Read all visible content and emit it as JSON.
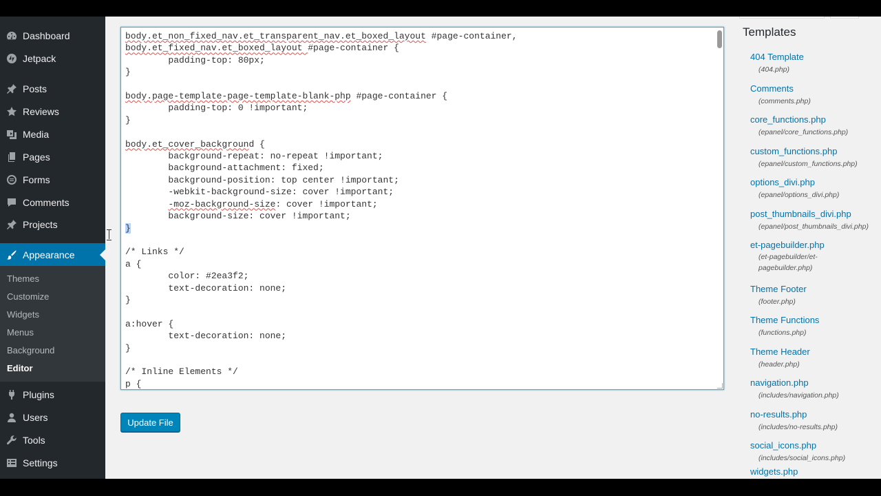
{
  "sidebar": {
    "items": [
      {
        "label": "Dashboard",
        "icon": "dashboard-icon"
      },
      {
        "label": "Jetpack",
        "icon": "jetpack-icon"
      },
      {
        "label": "Posts",
        "icon": "pin-icon"
      },
      {
        "label": "Reviews",
        "icon": "star-icon"
      },
      {
        "label": "Media",
        "icon": "media-icon"
      },
      {
        "label": "Pages",
        "icon": "page-icon"
      },
      {
        "label": "Forms",
        "icon": "forms-icon"
      },
      {
        "label": "Comments",
        "icon": "comment-icon"
      },
      {
        "label": "Projects",
        "icon": "pin-icon"
      },
      {
        "label": "Appearance",
        "icon": "brush-icon"
      },
      {
        "label": "Plugins",
        "icon": "plug-icon"
      },
      {
        "label": "Users",
        "icon": "user-icon"
      },
      {
        "label": "Tools",
        "icon": "wrench-icon"
      },
      {
        "label": "Settings",
        "icon": "settings-icon"
      }
    ],
    "active": "Appearance",
    "submenu": [
      "Themes",
      "Customize",
      "Widgets",
      "Menus",
      "Background",
      "Editor"
    ],
    "submenu_current": "Editor"
  },
  "editor": {
    "code_lines": [
      "body.et_non_fixed_nav.et_transparent_nav.et_boxed_layout #page-container,",
      "body.et_fixed_nav.et_boxed_layout #page-container {",
      "        padding-top: 80px;",
      "}",
      "",
      "body.page-template-page-template-blank-php #page-container {",
      "        padding-top: 0 !important;",
      "}",
      "",
      "body.et_cover_background {",
      "        background-repeat: no-repeat !important;",
      "        background-attachment: fixed;",
      "        background-position: top center !important;",
      "        -webkit-background-size: cover !important;",
      "        -moz-background-size: cover !important;",
      "        background-size: cover !important;",
      "}",
      "",
      "/* Links */",
      "a {",
      "        color: #2ea3f2;",
      "        text-decoration: none;",
      "}",
      "",
      "a:hover {",
      "        text-decoration: none;",
      "}",
      "",
      "/* Inline Elements */",
      "p {"
    ],
    "update_button": "Update File"
  },
  "templates": {
    "title": "Templates",
    "items": [
      {
        "name": "404 Template",
        "file": "(404.php)"
      },
      {
        "name": "Comments",
        "file": "(comments.php)"
      },
      {
        "name": "core_functions.php",
        "file": "(epanel/core_functions.php)"
      },
      {
        "name": "custom_functions.php",
        "file": "(epanel/custom_functions.php)"
      },
      {
        "name": "options_divi.php",
        "file": "(epanel/options_divi.php)"
      },
      {
        "name": "post_thumbnails_divi.php",
        "file": "(epanel/post_thumbnails_divi.php)"
      },
      {
        "name": "et-pagebuilder.php",
        "file": "(et-pagebuilder/et-pagebuilder.php)"
      },
      {
        "name": "Theme Footer",
        "file": "(footer.php)"
      },
      {
        "name": "Theme Functions",
        "file": "(functions.php)"
      },
      {
        "name": "Theme Header",
        "file": "(header.php)"
      },
      {
        "name": "navigation.php",
        "file": "(includes/navigation.php)"
      },
      {
        "name": "no-results.php",
        "file": "(includes/no-results.php)"
      },
      {
        "name": "social_icons.php",
        "file": "(includes/social_icons.php)"
      },
      {
        "name": "widgets.php",
        "file": ""
      }
    ]
  },
  "colors": {
    "sidebar_bg": "#23282d",
    "accent": "#0073aa",
    "button": "#0085ba"
  }
}
